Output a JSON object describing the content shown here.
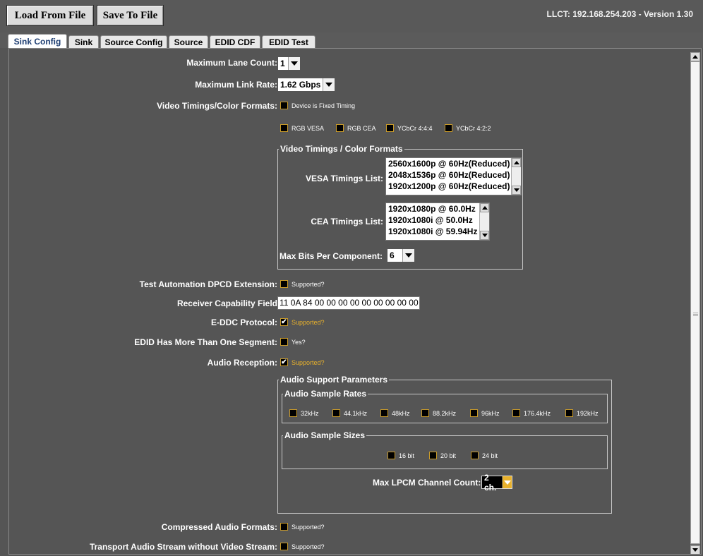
{
  "toolbar": {
    "load_label": "Load From File",
    "save_label": "Save To File",
    "status": "LLCT: 192.168.254.203 - Version 1.30"
  },
  "tabs": [
    "Sink Config",
    "Sink",
    "Source Config",
    "Source",
    "EDID CDF",
    "EDID Test"
  ],
  "form": {
    "max_lane_count": {
      "label": "Maximum Lane Count:",
      "value": "1"
    },
    "max_link_rate": {
      "label": "Maximum Link Rate:",
      "value": "1.62 Gbps"
    },
    "video_timings": {
      "label": "Video Timings/Color Formats:",
      "fixed_timing": "Device is Fixed Timing",
      "formats": [
        "RGB VESA",
        "RGB CEA",
        "YCbCr 4:4:4",
        "YCbCr 4:2:2"
      ]
    },
    "timings_group": {
      "legend": "Video Timings / Color Formats",
      "vesa_label": "VESA Timings List:",
      "vesa_items": [
        "2560x1600p @ 60Hz(Reduced)",
        "2048x1536p @ 60Hz(Reduced)",
        "1920x1200p @ 60Hz(Reduced)"
      ],
      "cea_label": "CEA Timings List:",
      "cea_items": [
        "1920x1080p @ 60.0Hz",
        "1920x1080i @ 50.0Hz",
        "1920x1080i @ 59.94Hz"
      ],
      "max_bits_label": "Max Bits Per Component:",
      "max_bits_value": "6"
    },
    "test_automation": {
      "label": "Test Automation DPCD Extension:",
      "option": "Supported?"
    },
    "receiver_capability": {
      "label": "Receiver Capability Field",
      "value": "11 0A 84 00 00 00 00 00 00 00 00 00 00"
    },
    "eddc_protocol": {
      "label": "E-DDC Protocol:",
      "option": "Supported?"
    },
    "edid_segments": {
      "label": "EDID Has More Than One Segment:",
      "option": "Yes?"
    },
    "audio_reception": {
      "label": "Audio Reception:",
      "option": "Supported?"
    },
    "audio_params": {
      "legend": "Audio Support Parameters",
      "rates_legend": "Audio Sample Rates",
      "rates": [
        "32kHz",
        "44.1kHz",
        "48kHz",
        "88.2kHz",
        "96kHz",
        "176.4kHz",
        "192kHz"
      ],
      "sizes_legend": "Audio Sample Sizes",
      "sizes": [
        "16 bit",
        "20 bit",
        "24 bit"
      ],
      "lpcm_label": "Max LPCM Channel Count:",
      "lpcm_value": "2 ch."
    },
    "compressed_audio": {
      "label": "Compressed Audio Formats:",
      "option": "Supported?"
    },
    "transport_audio": {
      "label": "Transport Audio Stream without Video Stream:",
      "option": "Supported?"
    }
  },
  "colors": {
    "background": "#555555",
    "accent": "#e8b12c",
    "checkbox_border": "#c89a2a"
  }
}
